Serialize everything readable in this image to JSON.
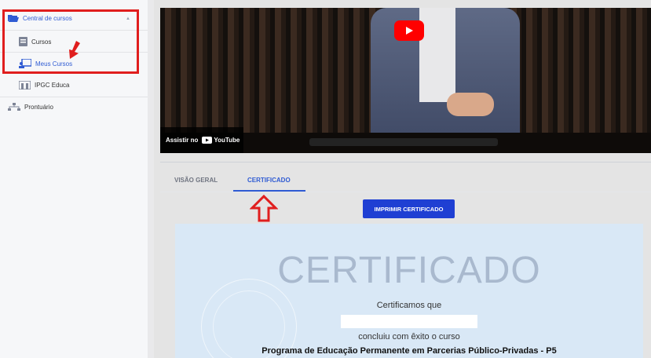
{
  "sidebar": {
    "items": [
      {
        "label": "Central de cursos",
        "icon": "folder-open-icon"
      },
      {
        "label": "Cursos",
        "icon": "book-icon"
      },
      {
        "label": "Meus Cursos",
        "icon": "classroom-icon"
      },
      {
        "label": "IPGC Educa",
        "icon": "building-icon"
      },
      {
        "label": "Prontuário",
        "icon": "sitemap-icon"
      }
    ]
  },
  "video": {
    "watch_on": "Assistir no",
    "platform": "YouTube"
  },
  "tabs": [
    {
      "label": "VISÃO GERAL",
      "active": false
    },
    {
      "label": "CERTIFICADO",
      "active": true
    }
  ],
  "actions": {
    "print_certificate": "IMPRIMIR CERTIFICADO"
  },
  "certificate": {
    "title": "CERTIFICADO",
    "line1": "Certificamos que",
    "line2": "concluiu com êxito o curso",
    "course": "Programa de Educação Permanente em Parcerias Público-Privadas - P5"
  },
  "colors": {
    "accent": "#2f5bd3",
    "button": "#1f3fd3",
    "annotation": "#e01e1e",
    "certificate_bg": "#d9e8f6"
  }
}
